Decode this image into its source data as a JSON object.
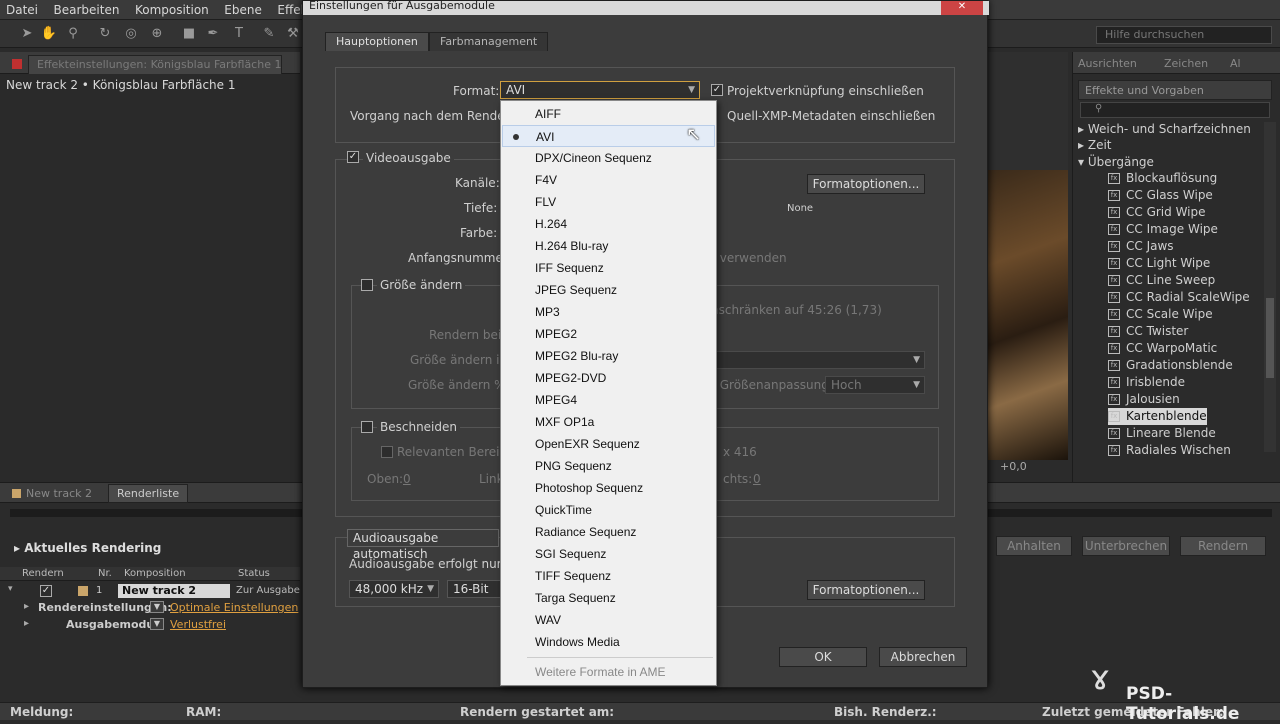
{
  "menubar": [
    "Datei",
    "Bearbeiten",
    "Komposition",
    "Ebene",
    "Effekte"
  ],
  "help_search_placeholder": "Hilfe durchsuchen",
  "left_panel": {
    "tab": "Effekteinstellungen: Königsblau Farbfläche 1",
    "breadcrumb": "New track 2 • Königsblau Farbfläche 1"
  },
  "right_panel": {
    "tabs": [
      "Ausrichten",
      "Zeichen",
      "Al"
    ],
    "effects_tab": "Effekte und Vorgaben",
    "folders": [
      "Weich- und Scharfzeichnen",
      "Zeit",
      "Übergänge"
    ],
    "items": [
      "Blockauflösung",
      "CC Glass Wipe",
      "CC Grid Wipe",
      "CC Image Wipe",
      "CC Jaws",
      "CC Light Wipe",
      "CC Line Sweep",
      "CC Radial ScaleWipe",
      "CC Scale Wipe",
      "CC Twister",
      "CC WarpoMatic",
      "Gradationsblende",
      "Irisblende",
      "Jalousien",
      "Kartenblende",
      "Lineare Blende",
      "Radiales Wischen"
    ],
    "selected": "Kartenblende",
    "comp_readout": "+0,0"
  },
  "render_queue": {
    "tabs": [
      "New track 2",
      "Renderliste"
    ],
    "section": "Aktuelles Rendering",
    "buttons": [
      "Anhalten",
      "Unterbrechen",
      "Rendern"
    ],
    "columns": [
      "Rendern",
      "Nr.",
      "Komposition",
      "Status"
    ],
    "row": {
      "nr": "1",
      "comp": "New track 2",
      "status": "Zur Ausgabe b"
    },
    "settings_label": "Rendereinstellungen:",
    "settings_value": "Optimale Einstellungen",
    "output_label": "Ausgabemodul:",
    "output_value": "Verlustfrei"
  },
  "statusbar": {
    "message": "Meldung:",
    "ram": "RAM:",
    "started": "Rendern gestartet am:",
    "elapsed": "Bish. Renderz.:",
    "last_error": "Zuletzt gemeldeter Fehler:"
  },
  "dialog": {
    "title": "Einstellungen für Ausgabemodule",
    "tabs": [
      "Hauptoptionen",
      "Farbmanagement"
    ],
    "format_label": "Format:",
    "format_value": "AVI",
    "post_render_label": "Vorgang nach dem Rendern:",
    "project_link": "Projektverknüpfung einschließen",
    "xmp_metadata": "Quell-XMP-Metadaten einschließen",
    "video_output": "Videoausgabe",
    "channels": "Kanäle:",
    "depth": "Tiefe:",
    "color": "Farbe:",
    "start_number": "Anfangsnummer:",
    "format_options": "Formatoptionen...",
    "none": "None",
    "use_suffix": "r verwenden",
    "resize": "Größe ändern",
    "render_at": "Rendern bei:",
    "resize_to": "Größe ändern in:",
    "resize_pct": "Größe ändern %:",
    "lock_ratio": "nschränken auf 45:26 (1,73)",
    "resize_quality": "r Größenanpassung:",
    "quality_value": "Hoch",
    "crop": "Beschneiden",
    "roi": "Relevanten Bereich v",
    "crop_size": "x 416",
    "top": "Oben:",
    "top_val": "0",
    "left": "Link",
    "right": "chts:",
    "right_val": "0",
    "audio_auto": "Audioausgabe automatisch",
    "audio_note": "Audioausgabe erfolgt nur, we",
    "sample_rate": "48,000 kHz",
    "bit_depth": "16-Bit",
    "audio_format_options": "Formatoptionen...",
    "ok": "OK",
    "cancel": "Abbrechen"
  },
  "dropdown": {
    "items": [
      "AIFF",
      "AVI",
      "DPX/Cineon Sequenz",
      "F4V",
      "FLV",
      "H.264",
      "H.264 Blu-ray",
      "IFF Sequenz",
      "JPEG Sequenz",
      "MP3",
      "MPEG2",
      "MPEG2 Blu-ray",
      "MPEG2-DVD",
      "MPEG4",
      "MXF OP1a",
      "OpenEXR Sequenz",
      "PNG Sequenz",
      "Photoshop Sequenz",
      "QuickTime",
      "Radiance Sequenz",
      "SGI Sequenz",
      "TIFF Sequenz",
      "Targa Sequenz",
      "WAV",
      "Windows Media"
    ],
    "selected": "AVI",
    "more": "Weitere Formate in AME"
  },
  "watermark": "PSD-Tutorials.de"
}
